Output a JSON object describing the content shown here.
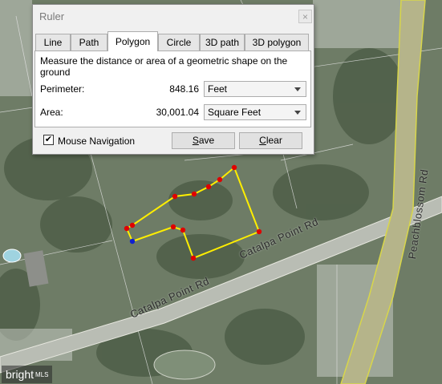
{
  "dialog": {
    "title": "Ruler",
    "close_glyph": "×",
    "tabs": [
      {
        "label": "Line",
        "active": false
      },
      {
        "label": "Path",
        "active": false
      },
      {
        "label": "Polygon",
        "active": true
      },
      {
        "label": "Circle",
        "active": false
      },
      {
        "label": "3D path",
        "active": false
      },
      {
        "label": "3D polygon",
        "active": false
      }
    ],
    "description": "Measure the distance or area of a geometric shape on the ground",
    "perimeter": {
      "label": "Perimeter:",
      "value": "848.16",
      "unit": "Feet"
    },
    "area": {
      "label": "Area:",
      "value": "30,001.04",
      "unit": "Square Feet"
    },
    "mouse_navigation": {
      "label": "Mouse Navigation",
      "checked": true,
      "check_glyph": "✔"
    },
    "buttons": {
      "save_first": "S",
      "save_rest": "ave",
      "clear_first": "C",
      "clear_rest": "lear"
    }
  },
  "map": {
    "road_labels": [
      "Catalpa Point Rd",
      "Catalpa Point Rd",
      "Peachblossom Rd"
    ],
    "watermark": {
      "text": "bright",
      "suffix": "MLS"
    },
    "polygon_color": "#ffee00",
    "vertex_color": "#e00000",
    "active_vertex_color": "#1020d0"
  }
}
